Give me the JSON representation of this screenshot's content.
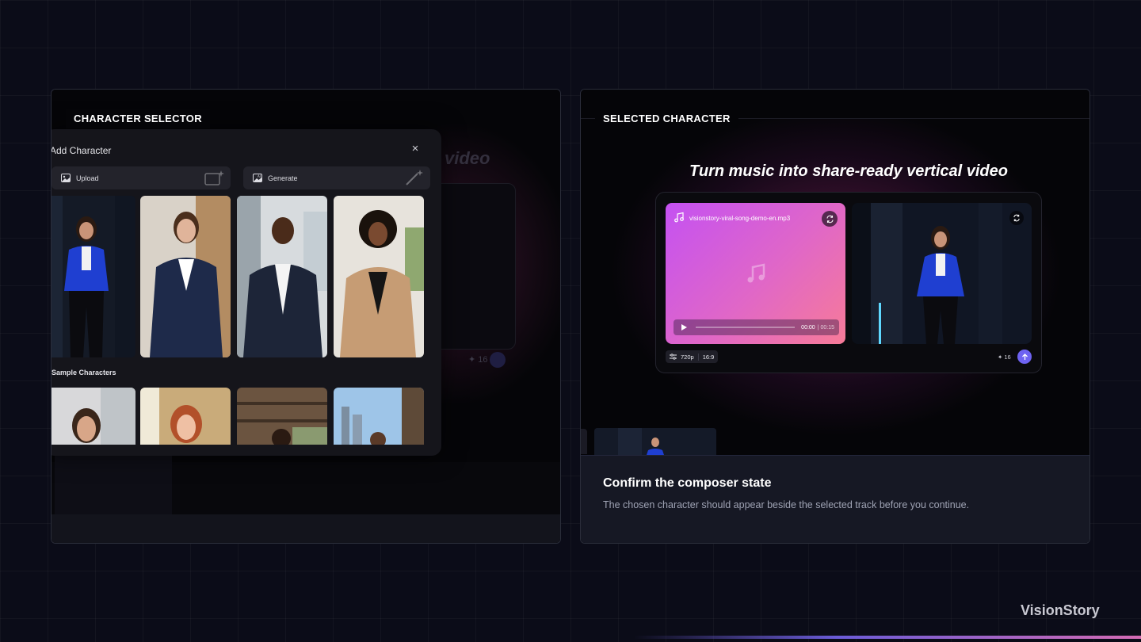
{
  "left_panel": {
    "tag": "CHARACTER SELECTOR",
    "background": {
      "heading_fragment": "video",
      "credits": "16"
    },
    "modal": {
      "title": "Add Character",
      "close_icon": "×",
      "upload_label": "Upload",
      "generate_label": "Generate",
      "sample_section_title": "Sample Characters"
    }
  },
  "right_panel": {
    "tag": "SELECTED CHARACTER",
    "heading": "Turn music into share-ready vertical video",
    "audio": {
      "file_name": "visionstory-viral-song-demo-en.mp3",
      "current_time": "00:00",
      "duration": "00:15",
      "progress": 0
    },
    "settings": {
      "resolution": "720p",
      "aspect_ratio": "16:9"
    },
    "credits": "16",
    "info": {
      "title": "Confirm the composer state",
      "description": "The chosen character should appear beside the selected track before you continue."
    }
  },
  "brand": "VisionStory",
  "colors": {
    "accent": "#6e63f2",
    "audio_gradient_start": "#c451f2",
    "audio_gradient_end": "#f77b98",
    "jacket_blue": "#1f3fd1"
  }
}
